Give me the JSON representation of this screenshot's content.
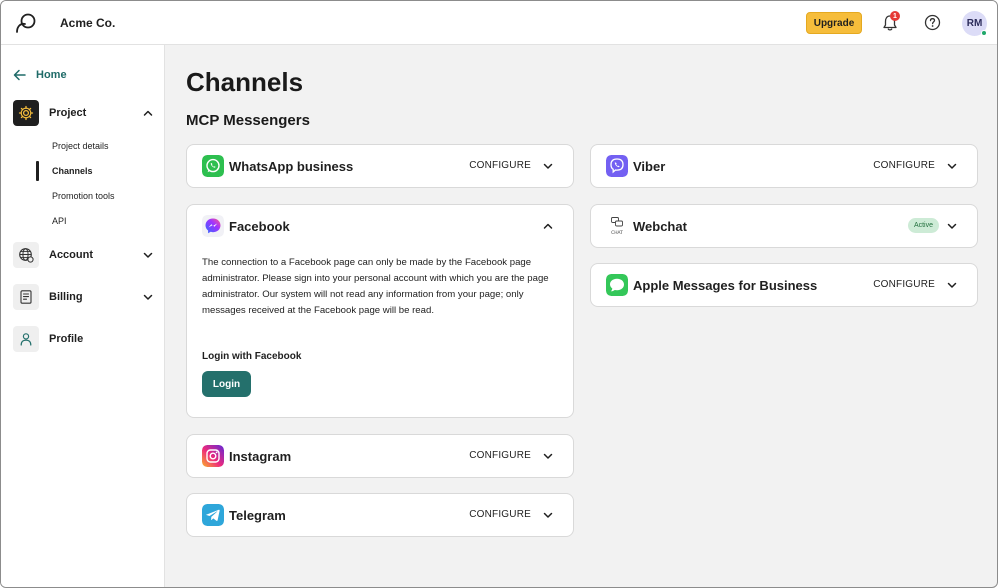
{
  "header": {
    "company": "Acme Co.",
    "upgrade_label": "Upgrade",
    "notification_count": "1",
    "avatar_initials": "RM"
  },
  "sidebar": {
    "home_label": "Home",
    "groups": [
      {
        "label": "Project",
        "icon": "gear-icon",
        "expanded": true
      },
      {
        "label": "Account",
        "icon": "globe-icon",
        "expanded": false
      },
      {
        "label": "Billing",
        "icon": "billing-icon",
        "expanded": false
      },
      {
        "label": "Profile",
        "icon": "person-icon"
      }
    ],
    "project_items": [
      {
        "label": "Project details",
        "active": false
      },
      {
        "label": "Channels",
        "active": true
      },
      {
        "label": "Promotion tools",
        "active": false
      },
      {
        "label": "API",
        "active": false
      }
    ]
  },
  "main": {
    "title": "Channels",
    "section_title": "MCP Messengers",
    "configure_label": "CONFIGURE",
    "channels_left": [
      {
        "name": "WhatsApp business",
        "icon": "whatsapp-icon",
        "action": "CONFIGURE"
      },
      {
        "name": "Facebook",
        "icon": "messenger-icon",
        "expanded": true
      },
      {
        "name": "Instagram",
        "icon": "instagram-icon",
        "action": "CONFIGURE"
      },
      {
        "name": "Telegram",
        "icon": "telegram-icon",
        "action": "CONFIGURE"
      }
    ],
    "channels_right": [
      {
        "name": "Viber",
        "icon": "viber-icon",
        "action": "CONFIGURE"
      },
      {
        "name": "Webchat",
        "icon": "chat-icon",
        "status": "Active",
        "icon_caption": "CHAT"
      },
      {
        "name": "Apple Messages for Business",
        "icon": "apple-messages-icon",
        "action": "CONFIGURE"
      }
    ],
    "facebook": {
      "description": "The connection to a Facebook page can only be made by the Facebook page administrator. Please sign into your personal account with which you are the page administrator. Our system will not read any information from your page; only messages received at the Facebook page will be read.",
      "login_label": "Login with Facebook",
      "login_button": "Login"
    }
  },
  "colors": {
    "accent": "#24706c",
    "upgrade": "#f6bd3b",
    "whatsapp": "#2dbf4f",
    "viber": "#7360f2",
    "telegram": "#2ea6da",
    "active_badge": "#cdebd6"
  }
}
